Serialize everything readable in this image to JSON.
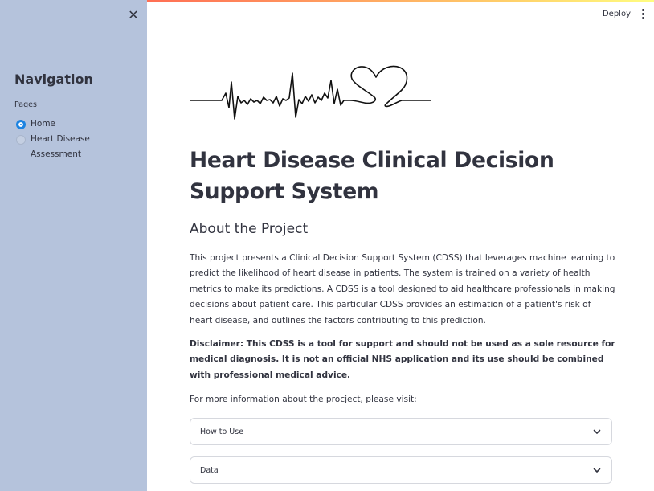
{
  "sidebar": {
    "close_icon": "close-icon",
    "title": "Navigation",
    "pages_label": "Pages",
    "pages": [
      {
        "label": "Home",
        "selected": true
      },
      {
        "label": "Heart Disease Assessment",
        "selected": false
      }
    ],
    "background": "#b5c3dc",
    "accent": "#1c83e1"
  },
  "header": {
    "deploy_label": "Deploy",
    "menu_icon": "kebab-menu-icon"
  },
  "main": {
    "logo_icon": "heartbeat-ecg-heart-icon",
    "title": "Heart Disease Clinical Decision Support System",
    "section_title": "About the Project",
    "intro": "This project presents a Clinical Decision Support System (CDSS) that leverages machine learning to predict the likelihood of heart disease in patients. The system is trained on a variety of health metrics to make its predictions. A CDSS is a tool designed to aid healthcare professionals in making decisions about patient care. This particular CDSS provides an estimation of a patient's risk of heart disease, and outlines the factors contributing to this prediction.",
    "disclaimer": "Disclaimer: This CDSS is a tool for support and should not be used as a sole resource for medical diagnosis. It is not an official NHS application and its use should be combined with professional medical advice.",
    "more_info": "For more information about the procject, please visit:",
    "expanders": [
      {
        "label": "How to Use"
      },
      {
        "label": "Data"
      }
    ]
  }
}
